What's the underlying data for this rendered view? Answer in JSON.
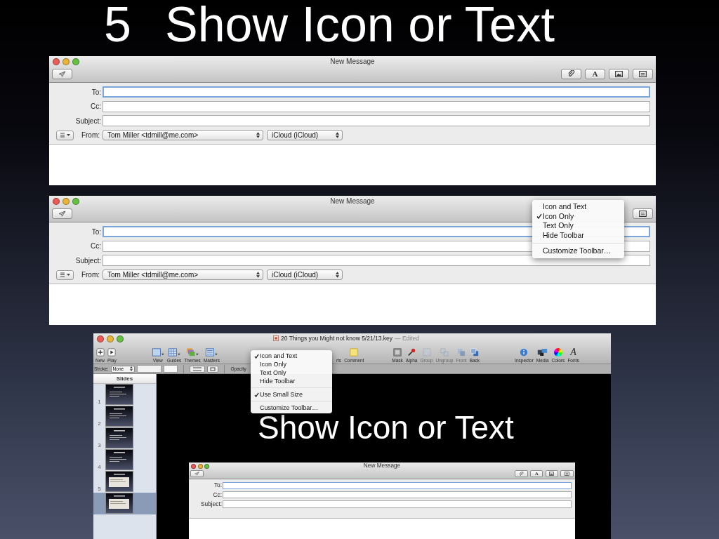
{
  "slide": {
    "number": "5",
    "title": "Show Icon or Text"
  },
  "mail_windows": [
    {
      "title": "New Message",
      "toolbar": [
        {
          "kind": "attach"
        },
        {
          "kind": "fonts",
          "glyph": "A"
        },
        {
          "kind": "photo"
        },
        {
          "kind": "stationery"
        }
      ],
      "fields": [
        {
          "label": "To:",
          "focused": true
        },
        {
          "label": "Cc:",
          "focused": false
        },
        {
          "label": "Subject:",
          "focused": false
        }
      ],
      "from_label": "From:",
      "from": "Tom Miller <tdmill@me.com>",
      "account": "iCloud (iCloud)"
    },
    {
      "title": "New Message",
      "toolbar": [
        {
          "kind": "stationery"
        }
      ],
      "fields": [
        {
          "label": "To:",
          "focused": true
        },
        {
          "label": "Cc:",
          "focused": false
        },
        {
          "label": "Subject:",
          "focused": false
        }
      ],
      "from_label": "From:",
      "from": "Tom Miller <tdmill@me.com>",
      "account": "iCloud (iCloud)",
      "menu": {
        "items": [
          {
            "label": "Icon and Text",
            "checked": false
          },
          {
            "label": "Icon Only",
            "checked": true
          },
          {
            "label": "Text Only",
            "checked": false
          },
          {
            "label": "Hide Toolbar",
            "checked": false
          },
          {
            "kind": "separator"
          },
          {
            "label": "Customize Toolbar…",
            "checked": false
          }
        ]
      }
    }
  ],
  "keynote": {
    "document": "20 Things you Might not know 5/21/13.key",
    "status": "— Edited",
    "toolbar": [
      {
        "items": [
          {
            "label": "New",
            "kind": "new",
            "disabled": false
          },
          {
            "label": "Play",
            "kind": "play",
            "disabled": false
          }
        ]
      },
      {
        "items": [
          {
            "label": "View",
            "kind": "view",
            "disabled": false
          },
          {
            "label": "Guides",
            "kind": "guides",
            "disabled": false
          },
          {
            "label": "Themes",
            "kind": "themes",
            "disabled": false
          },
          {
            "label": "Masters",
            "kind": "masters",
            "disabled": false
          }
        ]
      },
      {
        "items": [
          {
            "label": "rts",
            "kind": "label",
            "disabled": false
          },
          {
            "label": "Comment",
            "kind": "comment",
            "disabled": false
          }
        ]
      },
      {
        "items": [
          {
            "label": "Mask",
            "kind": "mask",
            "disabled": false
          },
          {
            "label": "Alpha",
            "kind": "alpha",
            "disabled": false
          },
          {
            "label": "Group",
            "kind": "group",
            "disabled": true
          },
          {
            "label": "Ungroup",
            "kind": "ungroup",
            "disabled": true
          },
          {
            "label": "Front",
            "kind": "front",
            "disabled": true
          },
          {
            "label": "Back",
            "kind": "back",
            "disabled": false
          }
        ]
      },
      {
        "items": [
          {
            "label": "Inspector",
            "kind": "inspector",
            "disabled": false
          },
          {
            "label": "Media",
            "kind": "media",
            "disabled": false
          },
          {
            "label": "Colors",
            "kind": "colors",
            "disabled": false
          },
          {
            "label": "Fonts",
            "kind": "fonts",
            "glyph": "A",
            "disabled": false
          }
        ]
      }
    ],
    "format_bar": {
      "stroke_label": "Stroke:",
      "stroke": "None",
      "opacity_label": "Opacity"
    },
    "menu": {
      "items": [
        {
          "label": "Icon and Text",
          "checked": true
        },
        {
          "label": "Icon Only",
          "checked": false
        },
        {
          "label": "Text Only",
          "checked": false
        },
        {
          "label": "Hide Toolbar",
          "checked": false
        },
        {
          "kind": "separator"
        },
        {
          "label": "Use Small Size",
          "checked": true
        },
        {
          "kind": "separator"
        },
        {
          "label": "Customize Toolbar…",
          "checked": false
        }
      ]
    },
    "sidebar": {
      "title": "Slides",
      "slides": [
        {
          "number": "1",
          "kind": "text",
          "selected": false
        },
        {
          "number": "2",
          "kind": "text",
          "selected": false
        },
        {
          "number": "3",
          "kind": "text",
          "selected": false
        },
        {
          "number": "4",
          "kind": "text",
          "selected": false
        },
        {
          "number": "5",
          "kind": "screenshot",
          "selected": false
        },
        {
          "kind": "screenshot",
          "selected": true
        }
      ]
    },
    "canvas": {
      "title": "Show Icon or Text",
      "mail": {
        "title": "New Message",
        "toolbar": [
          {
            "kind": "attach"
          },
          {
            "kind": "fonts",
            "glyph": "A"
          },
          {
            "kind": "photo"
          },
          {
            "kind": "stationery"
          }
        ],
        "fields": [
          {
            "label": "To:",
            "focused": true
          },
          {
            "label": "Cc:",
            "focused": false
          },
          {
            "label": "Subject:",
            "focused": false
          }
        ]
      }
    }
  }
}
